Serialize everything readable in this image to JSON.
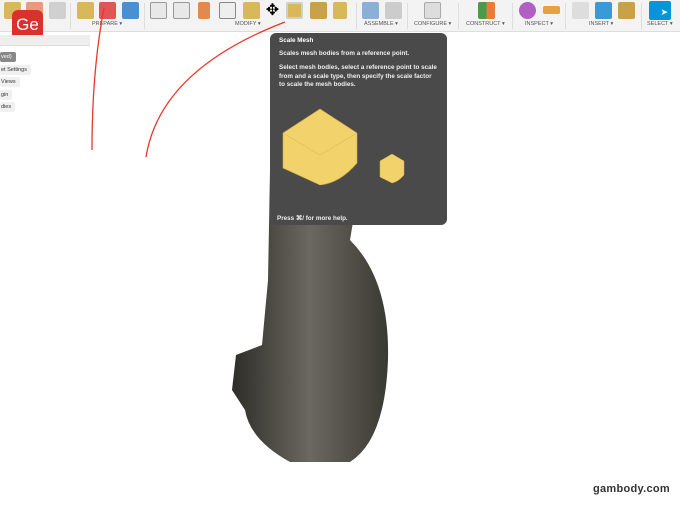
{
  "toolbar": {
    "groups": [
      "PREPARE ▾",
      "MODIFY ▾",
      "ASSEMBLE ▾",
      "CONFIGURE ▾",
      "CONSTRUCT ▾",
      "INSPECT ▾",
      "INSERT ▾",
      "SELECT ▾"
    ]
  },
  "logo": "Ge",
  "browser": {
    "items": [
      "ved)",
      "et Settings",
      "Views",
      "gin",
      "dies"
    ]
  },
  "tooltip": {
    "title": "Scale Mesh",
    "summary": "Scales mesh bodies from a reference point.",
    "description": "Select mesh bodies, select a reference point to scale from and a scale type, then specify the scale factor to scale the mesh bodies.",
    "help": "Press ⌘/ for more help."
  },
  "watermark": "gambody.com",
  "colors": {
    "accent": "#0696d7",
    "logo": "#d9312b",
    "arrow": "#e8372b",
    "mesh_yellow": "#f2d36b"
  }
}
